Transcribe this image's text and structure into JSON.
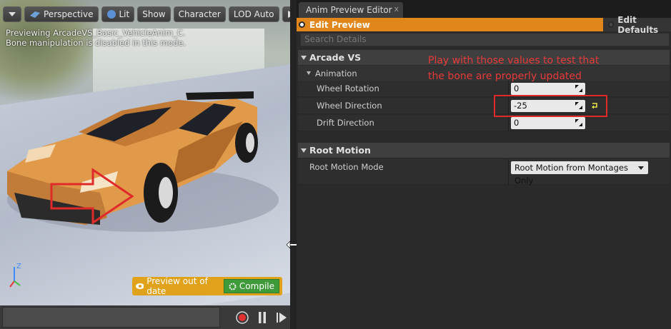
{
  "viewport": {
    "toolbar": {
      "perspective": "Perspective",
      "lit": "Lit",
      "show": "Show",
      "character": "Character",
      "lod": "LOD Auto",
      "overflow": "xT"
    },
    "info_line1": "Previewing ArcadeVS_Basic_VehicleAnim_C.",
    "info_line2": "Bone manipulation is disabled in this mode.",
    "preview_out_of_date": "Preview out of date",
    "compile": "Compile"
  },
  "panel": {
    "tab_title": "Anim Preview Editor",
    "tab_close": "x",
    "edit_preview": "Edit Preview",
    "edit_defaults": "Edit Defaults",
    "search_placeholder": "Search Details",
    "section_arcade": "Arcade VS",
    "subsection_animation": "Animation",
    "properties": [
      {
        "label": "Wheel Rotation",
        "value": "0"
      },
      {
        "label": "Wheel Direction",
        "value": "-25"
      },
      {
        "label": "Drift Direction",
        "value": "0"
      }
    ],
    "section_root_motion": "Root Motion",
    "root_motion_label": "Root Motion Mode",
    "root_motion_value": "Root Motion from Montages Only"
  },
  "annotation": {
    "line1": "Play with those values to test that",
    "line2": "the bone are properly updated"
  },
  "colors": {
    "edit_preview_orange": "#e0861a",
    "preview_bar_yellow": "#e0a21a",
    "compile_green": "#3f9a3a",
    "annotation_red": "#e83a3a",
    "car_orange": "#e09a4a"
  }
}
